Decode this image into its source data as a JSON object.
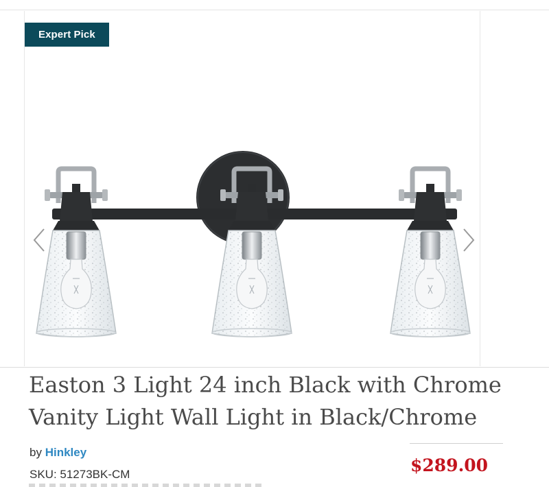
{
  "badge": {
    "label": "Expert Pick"
  },
  "gallery": {
    "prev_icon": "chevron-left-icon",
    "next_icon": "chevron-right-icon",
    "image": "vanity-light-fixture"
  },
  "product": {
    "title": "Easton 3 Light 24 inch Black with Chrome Vanity Light Wall Light in Black/Chrome",
    "by_prefix": "by",
    "brand": "Hinkley",
    "sku_label": "SKU: 51273BK-CM",
    "price": "$289.00"
  },
  "colors": {
    "badge_bg": "#0c4a5a",
    "brand_link": "#2f88c2",
    "price": "#c3141e"
  }
}
